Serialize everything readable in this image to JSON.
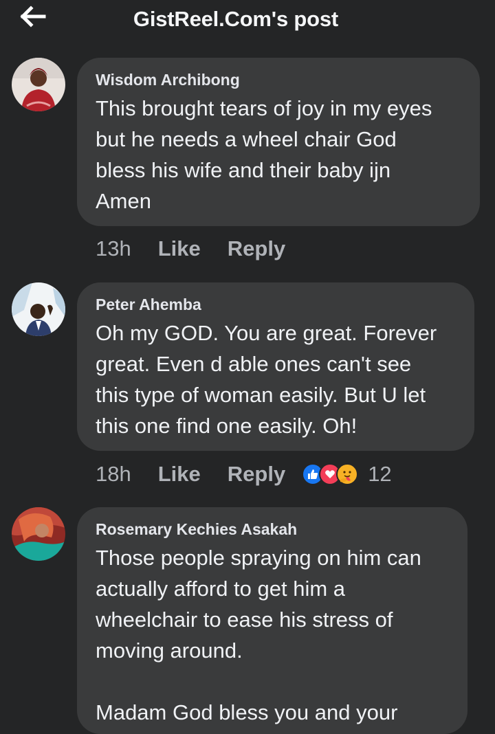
{
  "header": {
    "title": "GistReel.Com's post",
    "back_icon": "arrow-left-icon"
  },
  "comments": [
    {
      "author": "Wisdom Archibong",
      "text": "This brought tears of joy in my eyes\nbut he needs a wheel chair God\nbless his wife and their baby ijn\nAmen",
      "time": "13h",
      "like_label": "Like",
      "reply_label": "Reply"
    },
    {
      "author": "Peter Ahemba",
      "text": "Oh my GOD. You are great. Forever\ngreat. Even d able ones can't see\nthis type of woman easily. But U let\nthis one find one easily. Oh!",
      "time": "18h",
      "like_label": "Like",
      "reply_label": "Reply",
      "reactions": [
        "like-reaction-icon",
        "love-reaction-icon",
        "care-reaction-icon"
      ],
      "reaction_count": "12"
    },
    {
      "author": "Rosemary Kechies Asakah",
      "text": "Those people spraying on him can\nactually afford to get him a\nwheelchair to ease his stress of\nmoving around.\n\nMadam God bless you and your"
    }
  ],
  "colors": {
    "background": "#242526",
    "bubble": "#3a3b3c",
    "like_blue": "#1877f2",
    "love_red": "#f33e58",
    "care_yellow": "#f7b125"
  }
}
